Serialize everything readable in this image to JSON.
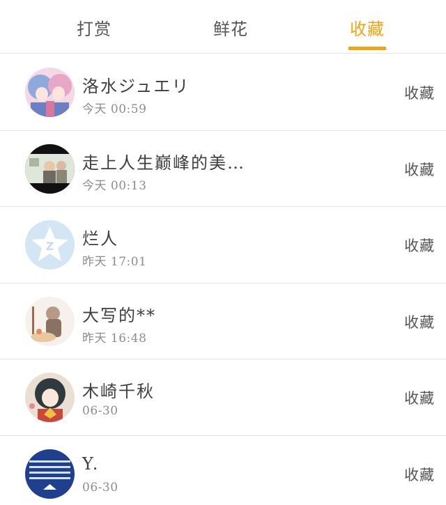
{
  "tabs": [
    {
      "label": "打赏",
      "active": false
    },
    {
      "label": "鲜花",
      "active": false
    },
    {
      "label": "收藏",
      "active": true
    }
  ],
  "colors": {
    "accent": "#f2a413",
    "divider": "#e4e4e4",
    "text": "#3f3f3f",
    "subtext": "#8c8c8c"
  },
  "items": [
    {
      "name": "洛水ジュエリ",
      "time": "今天 00:59",
      "action": "收藏",
      "avatar_icon": "anime-avatar-icon"
    },
    {
      "name": "走上人生巅峰的美…",
      "time": "今天 00:13",
      "action": "收藏",
      "avatar_icon": "photo-avatar-icon"
    },
    {
      "name": "烂人",
      "time": "昨天 17:01",
      "action": "收藏",
      "avatar_icon": "default-star-avatar-icon"
    },
    {
      "name": "大写的**",
      "time": "昨天 16:48",
      "action": "收藏",
      "avatar_icon": "illustration-avatar-icon"
    },
    {
      "name": "木崎千秋",
      "time": "06-30",
      "action": "收藏",
      "avatar_icon": "anime-avatar-icon"
    },
    {
      "name": "Y.",
      "time": "06-30",
      "action": "收藏",
      "avatar_icon": "blue-stripes-avatar-icon"
    }
  ]
}
